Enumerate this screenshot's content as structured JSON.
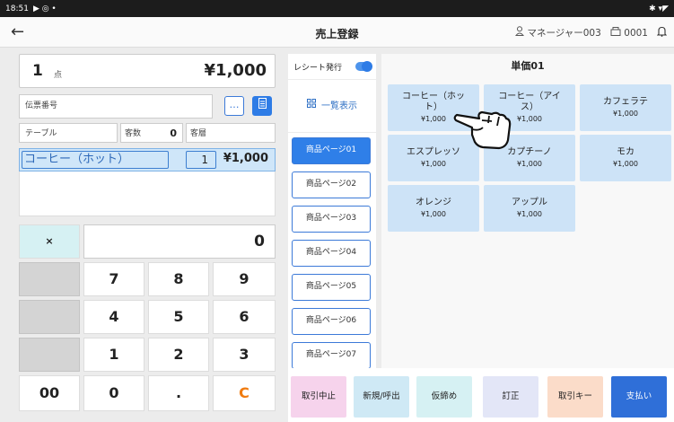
{
  "status_bar": {
    "time": "18:51",
    "left_icons": "▶ ◎ •",
    "right_icons": "✱ ▾◤"
  },
  "app_bar": {
    "title": "売上登録",
    "back_icon": "←",
    "user": "マネージャー003",
    "register": "0001"
  },
  "order": {
    "quantity": "1",
    "quantity_unit": "点",
    "total": "¥1,000",
    "slip_label": "伝票番号",
    "slip_button": "…",
    "table_label": "テーブル",
    "guests_label": "客数",
    "guests_value": "0",
    "customer_type_label": "客層",
    "line_item": {
      "name": "コーヒー（ホット）",
      "qty": "1",
      "price": "¥1,000"
    }
  },
  "keypad": {
    "multiply": "×",
    "display": "0",
    "keys": [
      "7",
      "8",
      "9",
      "4",
      "5",
      "6",
      "1",
      "2",
      "3",
      "00",
      "0",
      ".",
      "C"
    ]
  },
  "middle": {
    "receipt_label": "レシート発行",
    "receipt_on": true,
    "list_view_label": "一覧表示",
    "pages": [
      "商品ページ01",
      "商品ページ02",
      "商品ページ03",
      "商品ページ04",
      "商品ページ05",
      "商品ページ06",
      "商品ページ07"
    ],
    "active_page": 0
  },
  "products": {
    "header": "単価01",
    "items": [
      {
        "name": "コーヒー（ホット）",
        "price": "¥1,000"
      },
      {
        "name": "コーヒー（アイス）",
        "price": "¥1,000"
      },
      {
        "name": "カフェラテ",
        "price": "¥1,000"
      },
      {
        "name": "エスプレッソ",
        "price": "¥1,000"
      },
      {
        "name": "カプチーノ",
        "price": "¥1,000"
      },
      {
        "name": "モカ",
        "price": "¥1,000"
      },
      {
        "name": "オレンジ",
        "price": "¥1,000"
      },
      {
        "name": "アップル",
        "price": "¥1,000"
      }
    ]
  },
  "bottom_buttons": [
    {
      "label": "取引中止",
      "color": "#f6d3ec"
    },
    {
      "label": "新規/呼出",
      "color": "#cfe9f5"
    },
    {
      "label": "仮締め",
      "color": "#d6f1f3"
    },
    {
      "label": "訂正",
      "color": "#e3e6f7"
    },
    {
      "label": "取引キー",
      "color": "#fbdcc9"
    },
    {
      "label": "支払い",
      "color": "#2f6fd8"
    }
  ],
  "colors": {
    "accent": "#2e7ce6",
    "selection": "#cfe6f9",
    "product_tile": "#cde3f7",
    "clear_key": "#f07b10"
  }
}
